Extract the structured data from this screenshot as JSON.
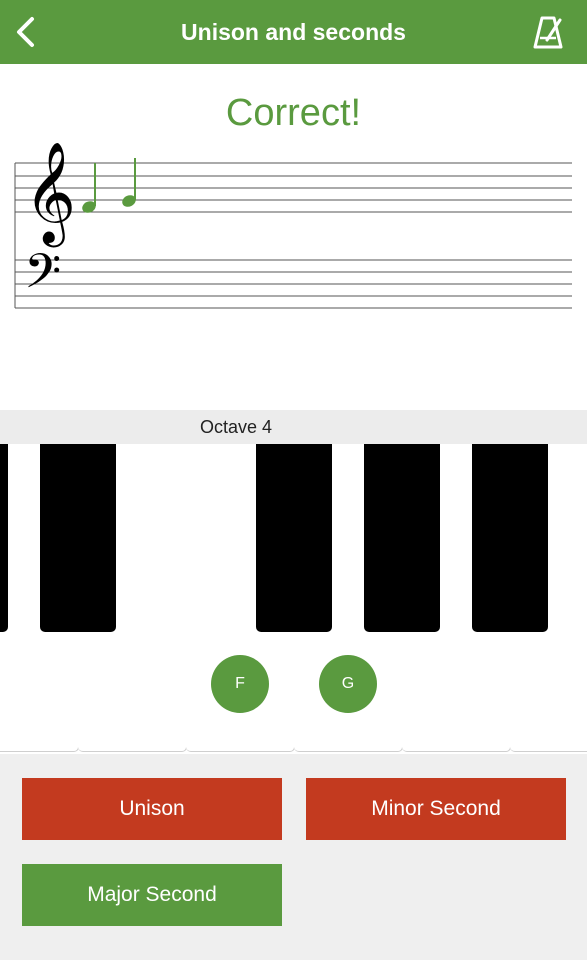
{
  "header": {
    "title": "Unison and seconds",
    "back_icon": "chevron-left-icon",
    "right_icon": "metronome-icon"
  },
  "feedback": {
    "text": "Correct!"
  },
  "staff": {
    "clefs": [
      "treble-clef",
      "bass-clef"
    ],
    "notes": [
      "F",
      "G"
    ]
  },
  "keyboard": {
    "octave_label": "Octave 4",
    "highlighted": [
      "F",
      "G"
    ]
  },
  "answers": [
    {
      "label": "Unison",
      "state": "wrong"
    },
    {
      "label": "Minor Second",
      "state": "wrong"
    },
    {
      "label": "Major Second",
      "state": "correct"
    }
  ],
  "colors": {
    "header": "#5a9a3f",
    "correct": "#5a9a3f",
    "wrong": "#c33a1f",
    "background": "#efefef"
  }
}
